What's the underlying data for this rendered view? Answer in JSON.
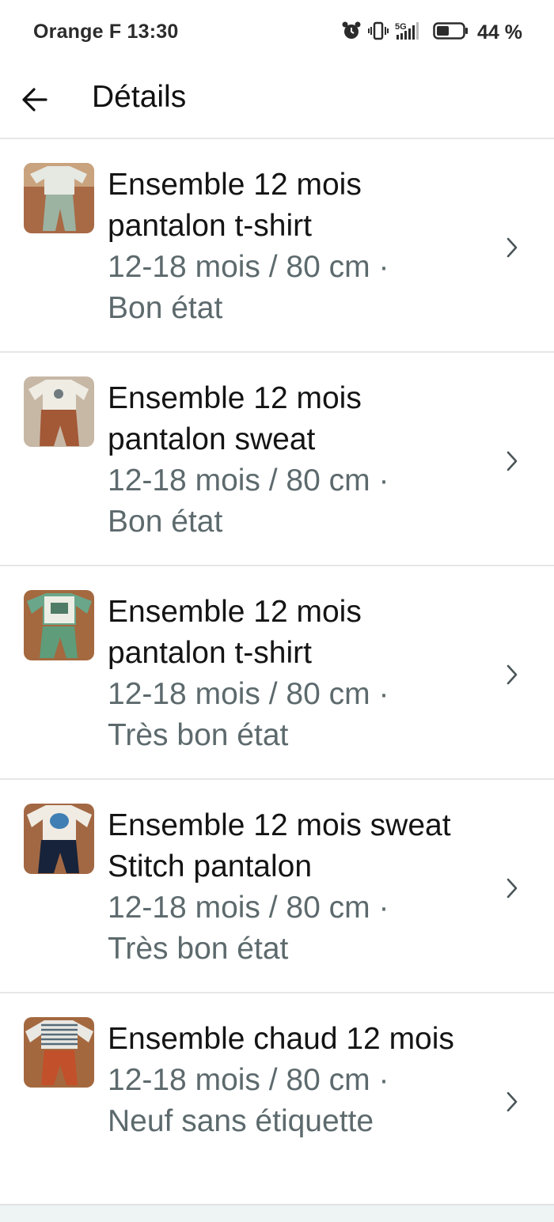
{
  "status": {
    "carrier_time": "Orange F 13:30",
    "network": "5G",
    "battery_percent": "44 %"
  },
  "header": {
    "title": "Détails"
  },
  "items": [
    {
      "title": "Ensemble 12 mois pantalon t-shirt",
      "size": "12-18 mois / 80 cm ·",
      "condition": "Bon état"
    },
    {
      "title": "Ensemble 12 mois pantalon sweat",
      "size": "12-18 mois / 80 cm ·",
      "condition": "Bon état"
    },
    {
      "title": "Ensemble 12 mois pantalon t-shirt",
      "size": "12-18 mois / 80 cm ·",
      "condition": "Très bon état"
    },
    {
      "title": "Ensemble 12 mois sweat Stitch pantalon",
      "size": "12-18 mois / 80 cm ·",
      "condition": "Très bon état"
    },
    {
      "title": "Ensemble chaud 12 mois",
      "size": "12-18 mois / 80 cm ·",
      "condition": "Neuf sans étiquette"
    }
  ],
  "icons": {
    "back": "arrow-left-icon",
    "chevron": "chevron-right-icon",
    "alarm": "alarm-icon",
    "vibrate": "vibrate-icon",
    "signal": "signal-icon",
    "battery": "battery-icon"
  },
  "colors": {
    "secondary_text": "#5d6a6d",
    "divider": "#e6e6e6"
  }
}
